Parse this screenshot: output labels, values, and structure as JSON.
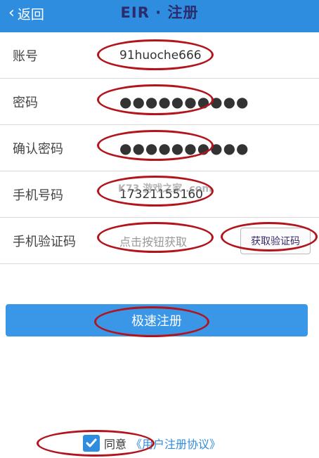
{
  "header": {
    "back_label": "返回",
    "title": "EIR · 注册"
  },
  "form": {
    "rows": [
      {
        "label": "账号",
        "value": "91huoche666"
      },
      {
        "label": "密码",
        "value": "●●●●●●●●●●"
      },
      {
        "label": "确认密码",
        "value": "●●●●●●●●●●"
      },
      {
        "label": "手机号码",
        "value": "17321155160"
      },
      {
        "label": "手机验证码",
        "placeholder": "点击按钮获取"
      }
    ],
    "get_code_label": "获取验证码"
  },
  "watermark": "K73 游戏之家 .com",
  "submit_label": "极速注册",
  "agreement": {
    "text": "同意",
    "link": "《用户注册协议》"
  },
  "colors": {
    "header_bg": "#2f8de0",
    "button_bg": "#3a96e6",
    "annotation": "#b3141c"
  }
}
